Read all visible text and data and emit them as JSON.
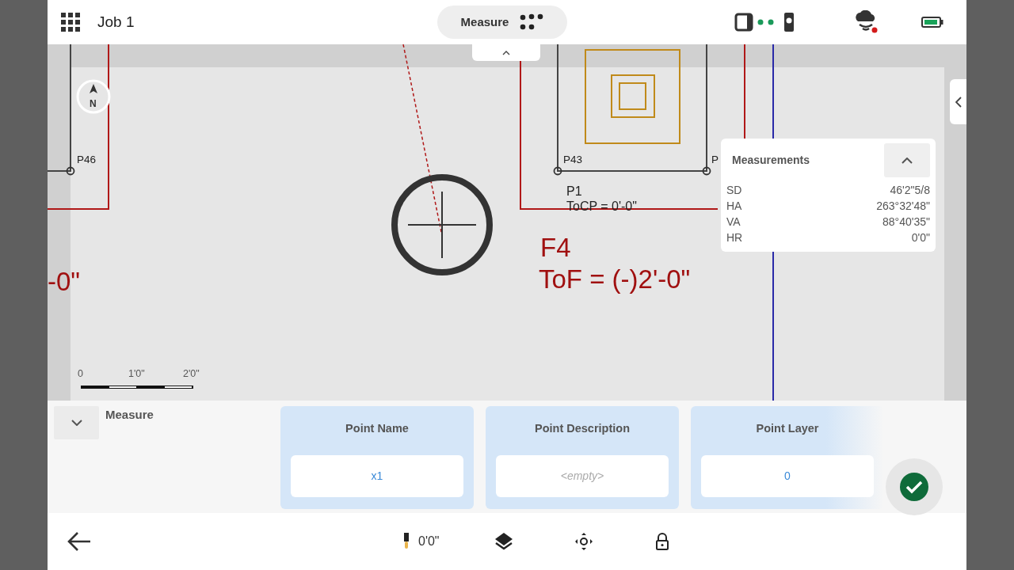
{
  "header": {
    "job_title": "Job 1",
    "mode_button": "Measure"
  },
  "map": {
    "north": "N",
    "points": [
      {
        "label": "P46"
      },
      {
        "label": "P43"
      },
      {
        "label": "P"
      }
    ],
    "stake_label": "P1",
    "stake_offset": "ToCP = 0'-0\"",
    "feature_label": "F4",
    "feature_offset": "ToF = (-)2'-0\"",
    "cut_label": "-0\"",
    "scale_ticks": [
      "0",
      "1'0\"",
      "2'0\""
    ]
  },
  "measurements": {
    "title": "Measurements",
    "rows": [
      {
        "label": "SD",
        "value": "46'2\"5/8"
      },
      {
        "label": "HA",
        "value": "263°32'48\""
      },
      {
        "label": "VA",
        "value": "88°40'35\""
      },
      {
        "label": "HR",
        "value": "0'0\""
      }
    ]
  },
  "measure_panel": {
    "title": "Measure",
    "fields": [
      {
        "label": "Point Name",
        "value": "x1"
      },
      {
        "label": "Point Description",
        "placeholder": "<empty>"
      },
      {
        "label": "Point Layer",
        "value": "0"
      }
    ]
  },
  "bottom_bar": {
    "target_height": "0'0\""
  }
}
